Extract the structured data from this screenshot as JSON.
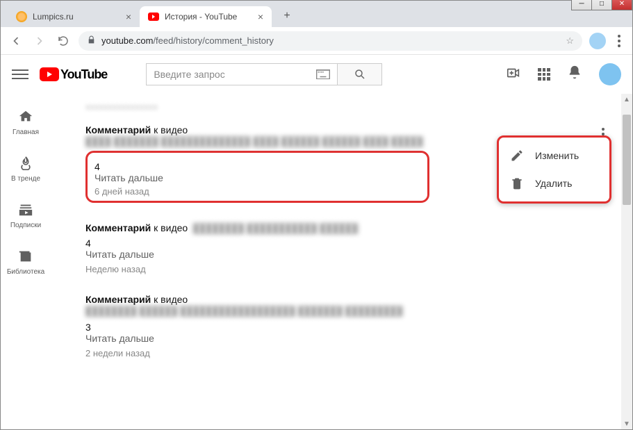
{
  "window": {
    "tabs": [
      {
        "title": "Lumpics.ru",
        "favicon": "#f5a623"
      },
      {
        "title": "История - YouTube",
        "favicon": "#ff0000"
      }
    ],
    "url_domain": "youtube.com",
    "url_path": "/feed/history/comment_history"
  },
  "youtube": {
    "logo_text": "YouTube",
    "search_placeholder": "Введите запрос",
    "sidebar": [
      {
        "label": "Главная",
        "icon": "home"
      },
      {
        "label": "В тренде",
        "icon": "fire"
      },
      {
        "label": "Подписки",
        "icon": "subs"
      },
      {
        "label": "Библиотека",
        "icon": "library"
      }
    ]
  },
  "comments": [
    {
      "prefix": "Комментарий",
      "suffix": " к видео",
      "body": "4",
      "read_more": "Читать дальше",
      "time": "6 дней назад",
      "highlighted": true
    },
    {
      "prefix": "Комментарий",
      "suffix": " к видео",
      "body": "4",
      "read_more": "Читать дальше",
      "time": "Неделю назад",
      "highlighted": false
    },
    {
      "prefix": "Комментарий",
      "suffix": " к видео",
      "body": "3",
      "read_more": "Читать дальше",
      "time": "2 недели назад",
      "highlighted": false
    }
  ],
  "menu": {
    "edit": "Изменить",
    "delete": "Удалить"
  }
}
